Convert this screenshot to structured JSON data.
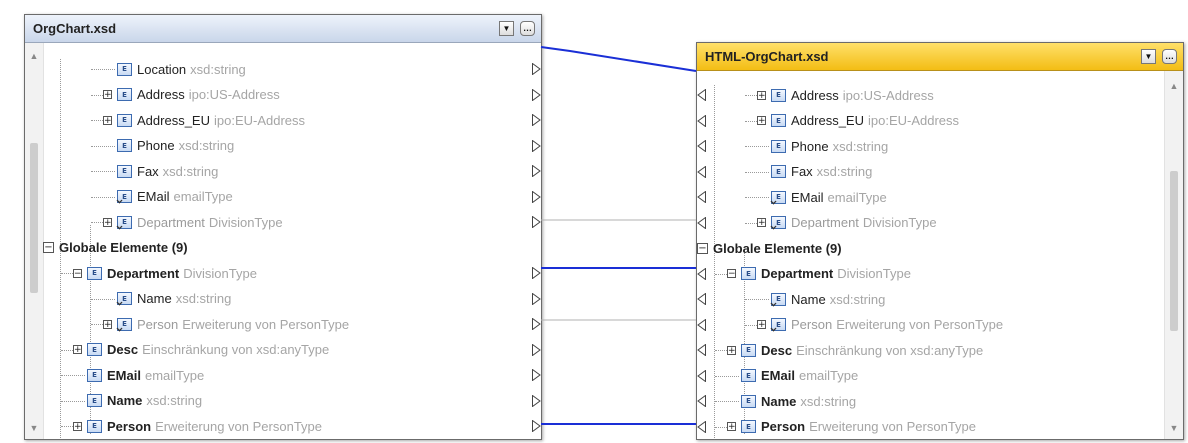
{
  "source": {
    "title": "OrgChart.xsd",
    "dropdown_icon": "chevron-down-icon",
    "options_icon": "ellipsis-icon",
    "rows": [
      {
        "indent": 3,
        "expander": "",
        "icon": "element",
        "name": "Location",
        "type": "xsd:string",
        "bold": false,
        "dim": false
      },
      {
        "indent": 3,
        "expander": "+",
        "icon": "element",
        "name": "Address",
        "type": "ipo:US-Address",
        "bold": false,
        "dim": false
      },
      {
        "indent": 3,
        "expander": "+",
        "icon": "element",
        "name": "Address_EU",
        "type": "ipo:EU-Address",
        "bold": false,
        "dim": false
      },
      {
        "indent": 3,
        "expander": "",
        "icon": "element",
        "name": "Phone",
        "type": "xsd:string",
        "bold": false,
        "dim": false
      },
      {
        "indent": 3,
        "expander": "",
        "icon": "element",
        "name": "Fax",
        "type": "xsd:string",
        "bold": false,
        "dim": false
      },
      {
        "indent": 3,
        "expander": "",
        "icon": "element-ref",
        "name": "EMail",
        "type": "emailType",
        "bold": false,
        "dim": false
      },
      {
        "indent": 3,
        "expander": "+",
        "icon": "element-ref",
        "name": "Department",
        "type": "DivisionType",
        "bold": false,
        "dim": true
      },
      {
        "indent": 1,
        "expander": "-",
        "icon": "none",
        "name": "Globale Elemente (9)",
        "type": "",
        "bold": true,
        "dim": false
      },
      {
        "indent": 2,
        "expander": "-",
        "icon": "element",
        "name": "Department",
        "type": "DivisionType",
        "bold": true,
        "dim": false
      },
      {
        "indent": 3,
        "expander": "",
        "icon": "element-ref",
        "name": "Name",
        "type": "xsd:string",
        "bold": false,
        "dim": false
      },
      {
        "indent": 3,
        "expander": "+",
        "icon": "element-ref",
        "name": "Person",
        "type": "Erweiterung von PersonType",
        "bold": false,
        "dim": true
      },
      {
        "indent": 2,
        "expander": "+",
        "icon": "element",
        "name": "Desc",
        "type": "Einschränkung von xsd:anyType",
        "bold": true,
        "dim": false
      },
      {
        "indent": 2,
        "expander": "",
        "icon": "element",
        "name": "EMail",
        "type": "emailType",
        "bold": true,
        "dim": false
      },
      {
        "indent": 2,
        "expander": "",
        "icon": "element",
        "name": "Name",
        "type": "xsd:string",
        "bold": true,
        "dim": false
      },
      {
        "indent": 2,
        "expander": "+",
        "icon": "element",
        "name": "Person",
        "type": "Erweiterung von PersonType",
        "bold": true,
        "dim": false
      }
    ]
  },
  "target": {
    "title": "HTML-OrgChart.xsd",
    "dropdown_icon": "chevron-down-icon",
    "options_icon": "ellipsis-icon",
    "rows": [
      {
        "indent": 3,
        "expander": "+",
        "icon": "element",
        "name": "Address",
        "type": "ipo:US-Address",
        "bold": false,
        "dim": false
      },
      {
        "indent": 3,
        "expander": "+",
        "icon": "element",
        "name": "Address_EU",
        "type": "ipo:EU-Address",
        "bold": false,
        "dim": false
      },
      {
        "indent": 3,
        "expander": "",
        "icon": "element",
        "name": "Phone",
        "type": "xsd:string",
        "bold": false,
        "dim": false
      },
      {
        "indent": 3,
        "expander": "",
        "icon": "element",
        "name": "Fax",
        "type": "xsd:string",
        "bold": false,
        "dim": false
      },
      {
        "indent": 3,
        "expander": "",
        "icon": "element-ref",
        "name": "EMail",
        "type": "emailType",
        "bold": false,
        "dim": false
      },
      {
        "indent": 3,
        "expander": "+",
        "icon": "element-ref",
        "name": "Department",
        "type": "DivisionType",
        "bold": false,
        "dim": true
      },
      {
        "indent": 1,
        "expander": "-",
        "icon": "none",
        "name": "Globale Elemente (9)",
        "type": "",
        "bold": true,
        "dim": false
      },
      {
        "indent": 2,
        "expander": "-",
        "icon": "element",
        "name": "Department",
        "type": "DivisionType",
        "bold": true,
        "dim": false
      },
      {
        "indent": 3,
        "expander": "",
        "icon": "element-ref",
        "name": "Name",
        "type": "xsd:string",
        "bold": false,
        "dim": false
      },
      {
        "indent": 3,
        "expander": "+",
        "icon": "element-ref",
        "name": "Person",
        "type": "Erweiterung von PersonType",
        "bold": false,
        "dim": true
      },
      {
        "indent": 2,
        "expander": "+",
        "icon": "element",
        "name": "Desc",
        "type": "Einschränkung von xsd:anyType",
        "bold": true,
        "dim": false
      },
      {
        "indent": 2,
        "expander": "",
        "icon": "element",
        "name": "EMail",
        "type": "emailType",
        "bold": true,
        "dim": false
      },
      {
        "indent": 2,
        "expander": "",
        "icon": "element",
        "name": "Name",
        "type": "xsd:string",
        "bold": true,
        "dim": false
      },
      {
        "indent": 2,
        "expander": "+",
        "icon": "element",
        "name": "Person",
        "type": "Erweiterung von PersonType",
        "bold": true,
        "dim": false
      }
    ]
  },
  "connections": {
    "active_color": "#1a2fd6",
    "inactive_color": "#b0b0b0"
  },
  "element_icon_label": "E"
}
